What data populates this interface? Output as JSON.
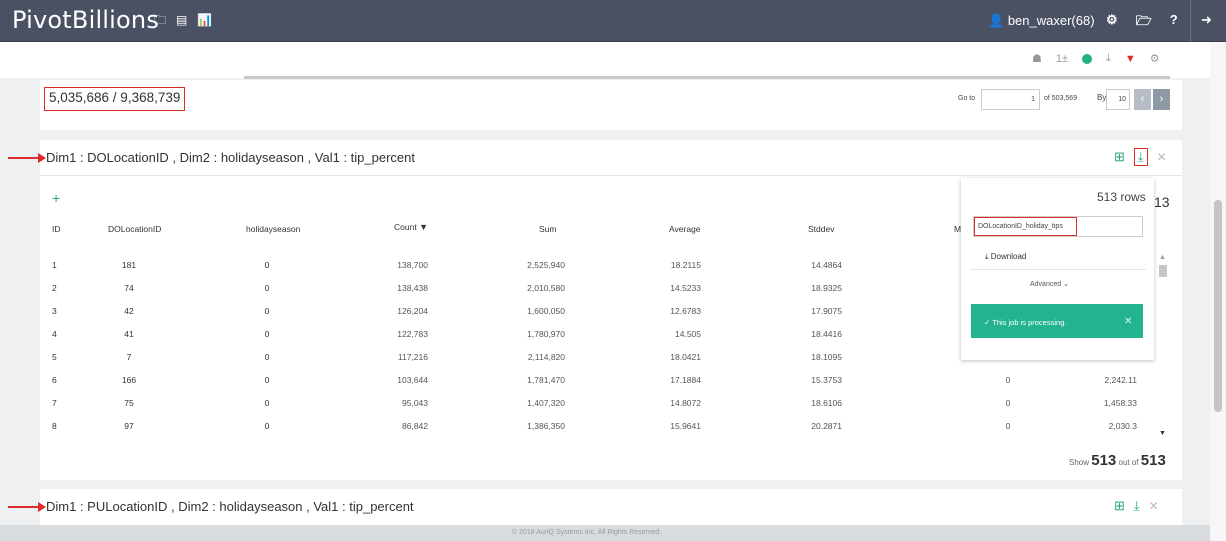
{
  "app": {
    "brand": "PivotBillions",
    "username": "ben_waxer(68)"
  },
  "toolbar": {
    "info_count": "1±"
  },
  "summary": {
    "counter": "5,035,686 / 9,368,739",
    "goto_label": "Go to",
    "page_value": "1",
    "of_pages": "of 503,569",
    "by_label": "By",
    "per_page": "10"
  },
  "section1": {
    "title": "Dim1 : DOLocationID , Dim2 : holidayseason , Val1 : tip_percent",
    "headers": [
      "ID",
      "DOLocationID",
      "holidayseason",
      "Count",
      "Sum",
      "Average",
      "Stddev",
      "Mi"
    ],
    "sort_marker": "▼",
    "rows": [
      [
        "1",
        "181",
        "0",
        "138,700",
        "2,525,940",
        "18.2115",
        "14.4864"
      ],
      [
        "2",
        "74",
        "0",
        "138,438",
        "2,010,580",
        "14.5233",
        "18.9325"
      ],
      [
        "3",
        "42",
        "0",
        "126,204",
        "1,600,050",
        "12.6783",
        "17.9075"
      ],
      [
        "4",
        "41",
        "0",
        "122,783",
        "1,780,970",
        "14.505",
        "18.4416"
      ],
      [
        "5",
        "7",
        "0",
        "117,216",
        "2,114,820",
        "18.0421",
        "18.1095"
      ],
      [
        "6",
        "166",
        "0",
        "103,644",
        "1,781,470",
        "17.1884",
        "15.3753",
        "0",
        "2,242.11"
      ],
      [
        "7",
        "75",
        "0",
        "95,043",
        "1,407,320",
        "14.8072",
        "18.6106",
        "0",
        "1,458.33"
      ],
      [
        "8",
        "97",
        "0",
        "86,842",
        "1,386,350",
        "15.9641",
        "20.2871",
        "0",
        "2,030.3"
      ]
    ],
    "show_prefix": "Show",
    "show_count": "513",
    "show_mid": "out of",
    "show_total": "513"
  },
  "download_popover": {
    "rows_label": "513 rows",
    "overflow_text": "13",
    "filename": "DOLocationID_holiday_tips",
    "download_label": "Download",
    "advanced_label": "Advanced",
    "toast_text": "This job is processing."
  },
  "section2": {
    "title": "Dim1 : PULocationID , Dim2 : holidayseason , Val1 : tip_percent"
  },
  "footer": {
    "text": "© 2018 AuriQ Systems Inc. All Rights Reserved."
  }
}
